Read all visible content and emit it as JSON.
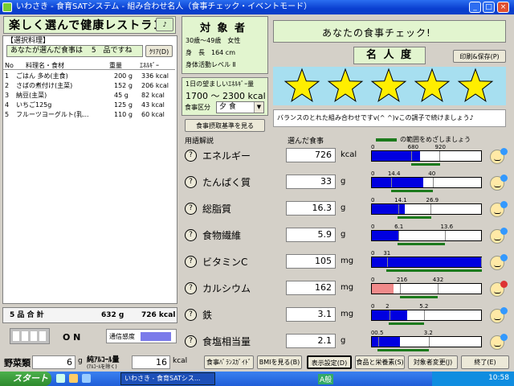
{
  "window": {
    "title": "いわさき - 食育SATシステム - 組み合わせ名人（食事チェック・イベントモード）"
  },
  "slogan": "楽しく選んで健康レストラン!",
  "selection": {
    "section_label": "【選択料理】",
    "count_prefix": "あなたが選んだ食事は",
    "count_value": "5",
    "count_suffix": "品ですね",
    "clear_button": "ｸﾘｱ(D)",
    "columns": [
      "No",
      "料理名・食材",
      "重量",
      "ｴﾈﾙｷﾞｰ"
    ],
    "items": [
      {
        "no": "1",
        "name": "ごはん 多め(主食)",
        "weight": "200 g",
        "energy": "336 kcal"
      },
      {
        "no": "2",
        "name": "さばの煮付け(主菜)",
        "weight": "152 g",
        "energy": "206 kcal"
      },
      {
        "no": "3",
        "name": "納豆(主菜)",
        "weight": "45 g",
        "energy": "82 kcal"
      },
      {
        "no": "4",
        "name": "いちご125g",
        "weight": "125 g",
        "energy": "43 kcal"
      },
      {
        "no": "5",
        "name": "フルーツヨーグルト(乳...",
        "weight": "110 g",
        "energy": "60 kcal"
      }
    ],
    "total_label": "5 品 合 計",
    "total_weight": "632 g",
    "total_energy": "726 kcal"
  },
  "status": {
    "on_label": "O N",
    "comm_label": "通信感度"
  },
  "target": {
    "title": "対 象 者",
    "age": "30歳～49歳　女性",
    "height": "身　長　164 cm",
    "activity": "身体活動レベル Ⅱ",
    "desired_label": "1日の望ましいｴﾈﾙｷﾞｰ量",
    "desired_value": "1700 ～ 2300 kcal",
    "meal_type_label": "食事区分",
    "meal_type_value": "夕 食",
    "standard_button": "食事摂取基準を見る"
  },
  "check": {
    "title": "あなたの食事チェック!",
    "rank_title": "名 人 度",
    "print_button": "印刷&保存(P)",
    "stars": 5,
    "message": "バランスのとれた組み合わせですv(^ ^)vこの調子で続けましょう♪"
  },
  "nutrients": {
    "term_label": "用語解説",
    "selected_label": "選んだ食事",
    "legend_label": "の範囲をめざしましょう",
    "items": [
      {
        "name": "エネルギー",
        "value": "726",
        "unit": "kcal",
        "n1": "680",
        "n2": "920",
        "fill": 0.44,
        "green_start": 0.36,
        "green_end": 0.62,
        "color": "#0000e0",
        "face": "ok"
      },
      {
        "name": "たんぱく質",
        "value": "33",
        "unit": "g",
        "n1": "14.4",
        "n2": "40",
        "fill": 0.47,
        "green_start": 0.18,
        "green_end": 0.56,
        "color": "#0000e0",
        "face": "ok"
      },
      {
        "name": "総脂質",
        "value": "16.3",
        "unit": "g",
        "n1": "14.1",
        "n2": "26.9",
        "fill": 0.3,
        "green_start": 0.24,
        "green_end": 0.54,
        "color": "#0000e0",
        "face": "ok"
      },
      {
        "name": "食物繊維",
        "value": "5.9",
        "unit": "g",
        "n1": "6.1",
        "n2": "13.6",
        "fill": 0.24,
        "green_start": 0.24,
        "green_end": 0.67,
        "color": "#0000e0",
        "face": "ok"
      },
      {
        "name": "ビタミンC",
        "value": "105",
        "unit": "mg",
        "n1": "31",
        "n2": "",
        "fill": 1.0,
        "green_start": 0.14,
        "green_end": 1.0,
        "color": "#0000e0",
        "face": "ok"
      },
      {
        "name": "カルシウム",
        "value": "162",
        "unit": "mg",
        "n1": "216",
        "n2": "432",
        "fill": 0.2,
        "green_start": 0.26,
        "green_end": 0.6,
        "color": "#f08a8a",
        "face": "bad"
      },
      {
        "name": "鉄",
        "value": "3.1",
        "unit": "mg",
        "n1": "2",
        "n2": "5.2",
        "fill": 0.32,
        "green_start": 0.16,
        "green_end": 0.48,
        "color": "#0000e0",
        "face": "ok"
      },
      {
        "name": "食塩相当量",
        "value": "2.1",
        "unit": "g",
        "n1": "0.5",
        "n2": "3.2",
        "fill": 0.26,
        "green_start": 0.06,
        "green_end": 0.52,
        "color": "#0000e0",
        "face": "ok"
      }
    ]
  },
  "bottom": {
    "veg_label": "野菜類",
    "veg_value": "6",
    "veg_unit": "g",
    "alcohol_label": "純ｱﾙｺｰﾙ量",
    "alcohol_sub": "(ｱﾙｺｰﾙを除く)",
    "alcohol_value": "16",
    "alcohol_unit": "kcal",
    "buttons": [
      "食事ﾊﾞﾗﾝｽｶﾞｲﾄﾞ",
      "BMIを見る(B)",
      "表示設定(D)",
      "食品と栄養素(S)",
      "対象者変更(J)",
      "終了(E)"
    ]
  },
  "taskbar": {
    "start": "スタート",
    "task": "いわさき - 食育SATシス...",
    "ime": "A般",
    "clock": "10:58"
  }
}
